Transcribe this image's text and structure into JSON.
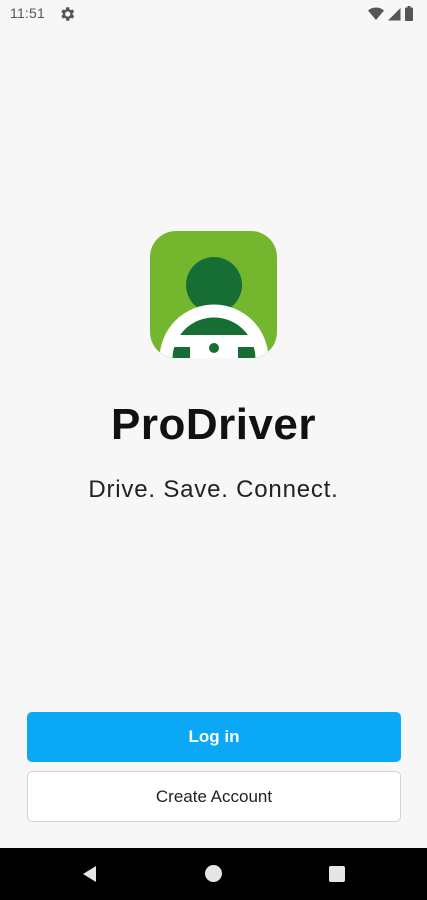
{
  "status_bar": {
    "time": "11:51",
    "icons": [
      "settings-gear-icon",
      "wifi-icon",
      "signal-icon",
      "battery-icon"
    ]
  },
  "logo": {
    "icon": "driver-steering-wheel-logo",
    "colors": {
      "background": "#74b72e",
      "figure": "#166e34",
      "wheel": "#ffffff"
    }
  },
  "app": {
    "name": "ProDriver",
    "tagline": "Drive. Save. Connect."
  },
  "actions": {
    "login_label": "Log in",
    "create_account_label": "Create Account"
  },
  "nav_bar": {
    "icons": [
      "back-icon",
      "home-icon",
      "recents-icon"
    ]
  },
  "colors": {
    "accent": "#0aa8f5",
    "background": "#f7f7f7"
  }
}
